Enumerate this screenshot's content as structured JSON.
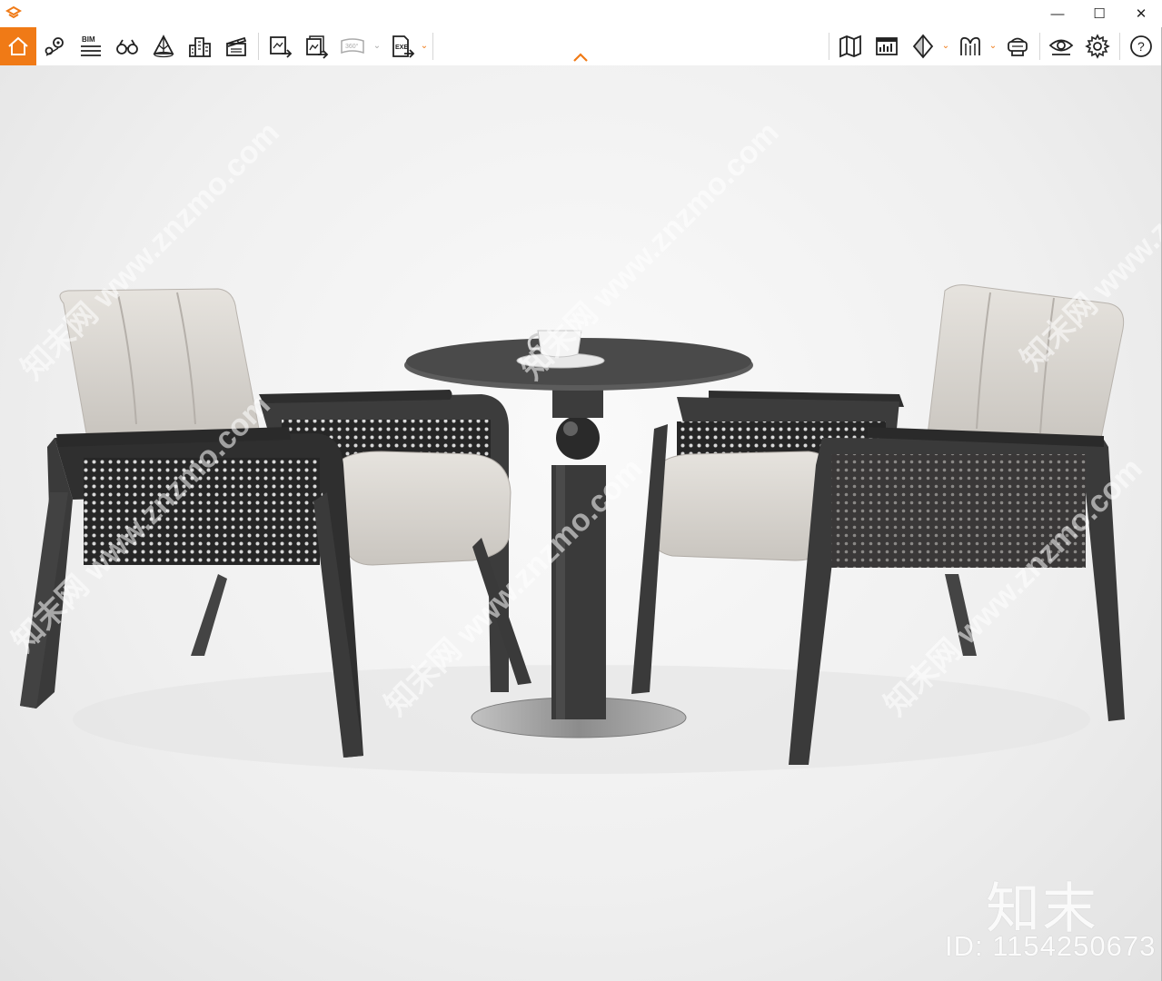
{
  "titlebar": {
    "logo_icon": "app-logo-icon",
    "controls": [
      "minimize-icon",
      "maximize-icon",
      "close-icon"
    ],
    "minimize_glyph": "—",
    "maximize_glyph": "☐",
    "close_glyph": "✕"
  },
  "toolbar": {
    "accent": "#f07a16",
    "left_tools": [
      {
        "name": "home",
        "icon": "home-icon",
        "active": true
      },
      {
        "name": "location",
        "icon": "map-pin-icon"
      },
      {
        "name": "bim",
        "icon": "bim-layers-icon",
        "label": "BIM"
      },
      {
        "name": "binoculars",
        "icon": "binoculars-icon"
      },
      {
        "name": "terrain",
        "icon": "terrain-icon"
      },
      {
        "name": "buildings",
        "icon": "buildings-icon"
      },
      {
        "name": "clapper",
        "icon": "clapperboard-icon"
      },
      {
        "name": "export-image",
        "icon": "export-image-icon"
      },
      {
        "name": "export-batch",
        "icon": "export-batch-icon"
      },
      {
        "name": "export-360",
        "icon": "export-360-icon",
        "label": "360°",
        "disabled": true
      },
      {
        "name": "export-exe",
        "icon": "export-exe-icon",
        "label": "EXE"
      }
    ],
    "right_tools": [
      {
        "name": "map",
        "icon": "folded-map-icon"
      },
      {
        "name": "panel",
        "icon": "panel-chart-icon"
      },
      {
        "name": "section",
        "icon": "section-diamond-icon"
      },
      {
        "name": "materials",
        "icon": "materials-icon"
      },
      {
        "name": "vr",
        "icon": "vr-headset-icon"
      },
      {
        "name": "view",
        "icon": "eye-icon"
      },
      {
        "name": "settings",
        "icon": "gear-icon"
      },
      {
        "name": "help",
        "icon": "help-circle-icon",
        "label": "?"
      }
    ],
    "collapse_icon": "chevron-up-icon"
  },
  "watermark": {
    "brand": "知末",
    "id_text": "ID: 1154250673",
    "diagonal_text": "知末网 www.znzmo.com"
  },
  "scene_colors": {
    "wood": "#4a4a4a",
    "cushion": "#dcd8d2",
    "cane": "#2a2a2a",
    "table_top": "#5a5a5a",
    "base": "#9a9a9a"
  }
}
